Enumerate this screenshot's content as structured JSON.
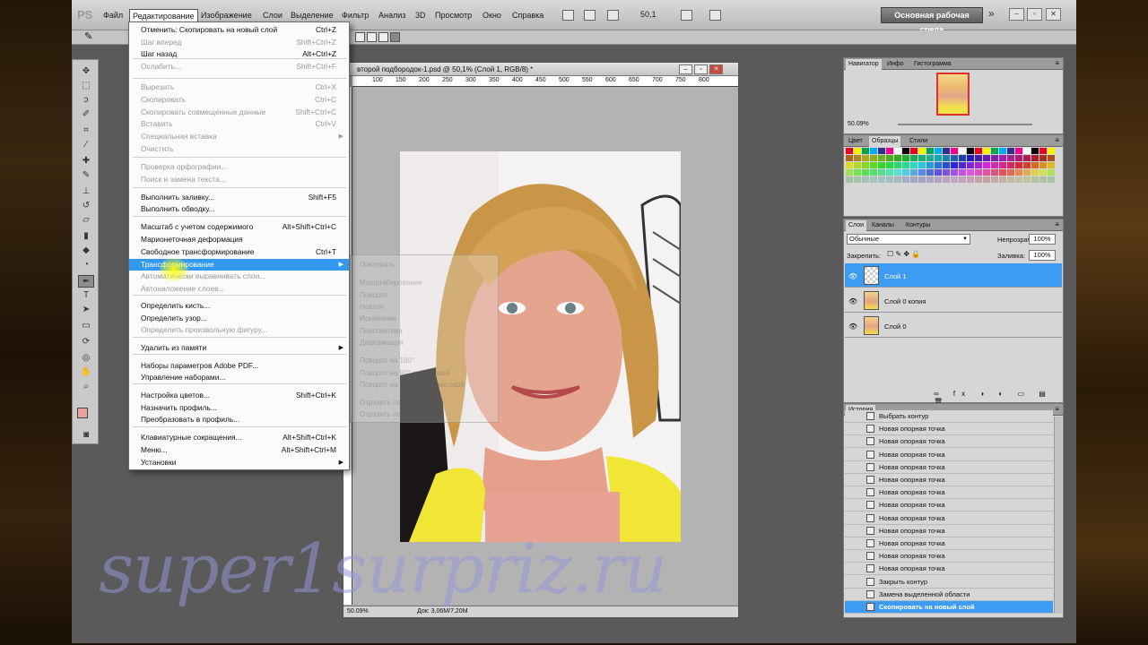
{
  "menubar": {
    "logo": "PS",
    "items": [
      "Файл",
      "Редактирование",
      "Изображение",
      "Слои",
      "Выделение",
      "Фильтр",
      "Анализ",
      "3D",
      "Просмотр",
      "Окно",
      "Справка"
    ],
    "active_index": 1,
    "zoom": "50,1",
    "workspace": "Основная рабочая среда",
    "cs_live": "»"
  },
  "edit_menu": {
    "items": [
      {
        "label": "Отменить: Скопировать на новый слой",
        "shortcut": "Ctrl+Z",
        "state": "normal"
      },
      {
        "label": "Шаг вперед",
        "shortcut": "Shift+Ctrl+Z",
        "state": "disabled"
      },
      {
        "label": "Шаг назад",
        "shortcut": "Alt+Ctrl+Z",
        "state": "normal"
      },
      {
        "label": "Ослабить...",
        "shortcut": "Shift+Ctrl+F",
        "state": "disabled"
      },
      {
        "label": "Вырезать",
        "shortcut": "Ctrl+X",
        "state": "disabled"
      },
      {
        "label": "Скопировать",
        "shortcut": "Ctrl+C",
        "state": "disabled"
      },
      {
        "label": "Скопировать совмещенные данные",
        "shortcut": "Shift+Ctrl+C",
        "state": "disabled"
      },
      {
        "label": "Вставить",
        "shortcut": "Ctrl+V",
        "state": "disabled"
      },
      {
        "label": "Специальная вставка",
        "shortcut": "",
        "state": "disabled",
        "submenu": true
      },
      {
        "label": "Очистить",
        "shortcut": "",
        "state": "disabled"
      },
      {
        "label": "Проверка орфографии...",
        "shortcut": "",
        "state": "disabled"
      },
      {
        "label": "Поиск и замена текста...",
        "shortcut": "",
        "state": "disabled"
      },
      {
        "label": "Выполнить заливку...",
        "shortcut": "Shift+F5",
        "state": "normal"
      },
      {
        "label": "Выполнить обводку...",
        "shortcut": "",
        "state": "normal"
      },
      {
        "label": "Масштаб с учетом содержимого",
        "shortcut": "Alt+Shift+Ctrl+C",
        "state": "normal"
      },
      {
        "label": "Марионеточная деформация",
        "shortcut": "",
        "state": "normal"
      },
      {
        "label": "Свободное трансформирование",
        "shortcut": "Ctrl+T",
        "state": "normal"
      },
      {
        "label": "Трансформирование",
        "shortcut": "",
        "state": "highlighted",
        "submenu": true
      },
      {
        "label": "Автоматически выравнивать слои...",
        "shortcut": "",
        "state": "disabled"
      },
      {
        "label": "Автоналожение слоев...",
        "shortcut": "",
        "state": "disabled"
      },
      {
        "label": "Определить кисть...",
        "shortcut": "",
        "state": "normal"
      },
      {
        "label": "Определить узор...",
        "shortcut": "",
        "state": "normal"
      },
      {
        "label": "Определить произвольную фигуру...",
        "shortcut": "",
        "state": "disabled"
      },
      {
        "label": "Удалить из памяти",
        "shortcut": "",
        "state": "normal",
        "submenu": true
      },
      {
        "label": "Наборы параметров Adobe PDF...",
        "shortcut": "",
        "state": "normal"
      },
      {
        "label": "Управление наборами...",
        "shortcut": "",
        "state": "normal"
      },
      {
        "label": "Настройка цветов...",
        "shortcut": "Shift+Ctrl+K",
        "state": "normal"
      },
      {
        "label": "Назначить профиль...",
        "shortcut": "",
        "state": "normal"
      },
      {
        "label": "Преобразовать в профиль...",
        "shortcut": "",
        "state": "normal"
      },
      {
        "label": "Клавиатурные сокращения...",
        "shortcut": "Alt+Shift+Ctrl+K",
        "state": "normal"
      },
      {
        "label": "Меню...",
        "shortcut": "Alt+Shift+Ctrl+M",
        "state": "normal"
      },
      {
        "label": "Установки",
        "shortcut": "",
        "state": "normal",
        "submenu": true
      }
    ]
  },
  "transform_submenu": [
    "Повторить",
    "Масштабирование",
    "Поворот",
    "Наклон",
    "Искажение",
    "Перспектива",
    "Деформация",
    "Поворот на 180°",
    "Поворот на 90° по часовой",
    "Поворот на 90° против часовой",
    "Отразить по горизонтали",
    "Отразить по вертикали"
  ],
  "document": {
    "title": "второй подбородок-1.psd @ 50,1% (Слой 1, RGB/8) *",
    "ruler_labels": [
      "100",
      "150",
      "200",
      "250",
      "300",
      "350",
      "400",
      "450",
      "500",
      "550",
      "600",
      "650",
      "700",
      "750",
      "800"
    ],
    "status_zoom": "50.09%",
    "status_doc": "Док: 3,06M/7,20M"
  },
  "navigator": {
    "tabs": [
      "Навигатор",
      "Инфо",
      "Гистограмма"
    ],
    "zoom": "50.09%"
  },
  "swatches_panel": {
    "tabs": [
      "Цвет",
      "Образцы",
      "Стили"
    ],
    "colors": [
      "#e8001c",
      "#fff200",
      "#00a651",
      "#00aeef",
      "#2e3192",
      "#ec008c",
      "#ffffff",
      "#000000"
    ]
  },
  "layers": {
    "tabs": [
      "Слои",
      "Каналы",
      "Контуры"
    ],
    "blend_mode": "Обычные",
    "opacity_label": "Непрозрачность:",
    "opacity": "100%",
    "lock_label": "Закрепить:",
    "fill_label": "Заливка:",
    "fill": "100%",
    "items": [
      {
        "name": "Слой 1",
        "selected": true
      },
      {
        "name": "Слой 0 копия",
        "selected": false
      },
      {
        "name": "Слой 0",
        "selected": false
      }
    ]
  },
  "history": {
    "tab": "История",
    "items": [
      {
        "label": "Выбрать контур",
        "selected": false
      },
      {
        "label": "Новая опорная точка",
        "selected": false
      },
      {
        "label": "Новая опорная точка",
        "selected": false
      },
      {
        "label": "Новая опорная точка",
        "selected": false
      },
      {
        "label": "Новая опорная точка",
        "selected": false
      },
      {
        "label": "Новая опорная точка",
        "selected": false
      },
      {
        "label": "Новая опорная точка",
        "selected": false
      },
      {
        "label": "Новая опорная точка",
        "selected": false
      },
      {
        "label": "Новая опорная точка",
        "selected": false
      },
      {
        "label": "Новая опорная точка",
        "selected": false
      },
      {
        "label": "Новая опорная точка",
        "selected": false
      },
      {
        "label": "Новая опорная точка",
        "selected": false
      },
      {
        "label": "Новая опорная точка",
        "selected": false
      },
      {
        "label": "Закрыть контур",
        "selected": false
      },
      {
        "label": "Замена выделенной области",
        "selected": false
      },
      {
        "label": "Скопировать на новый слой",
        "selected": true
      }
    ]
  },
  "watermark": "super1surpriz.ru"
}
